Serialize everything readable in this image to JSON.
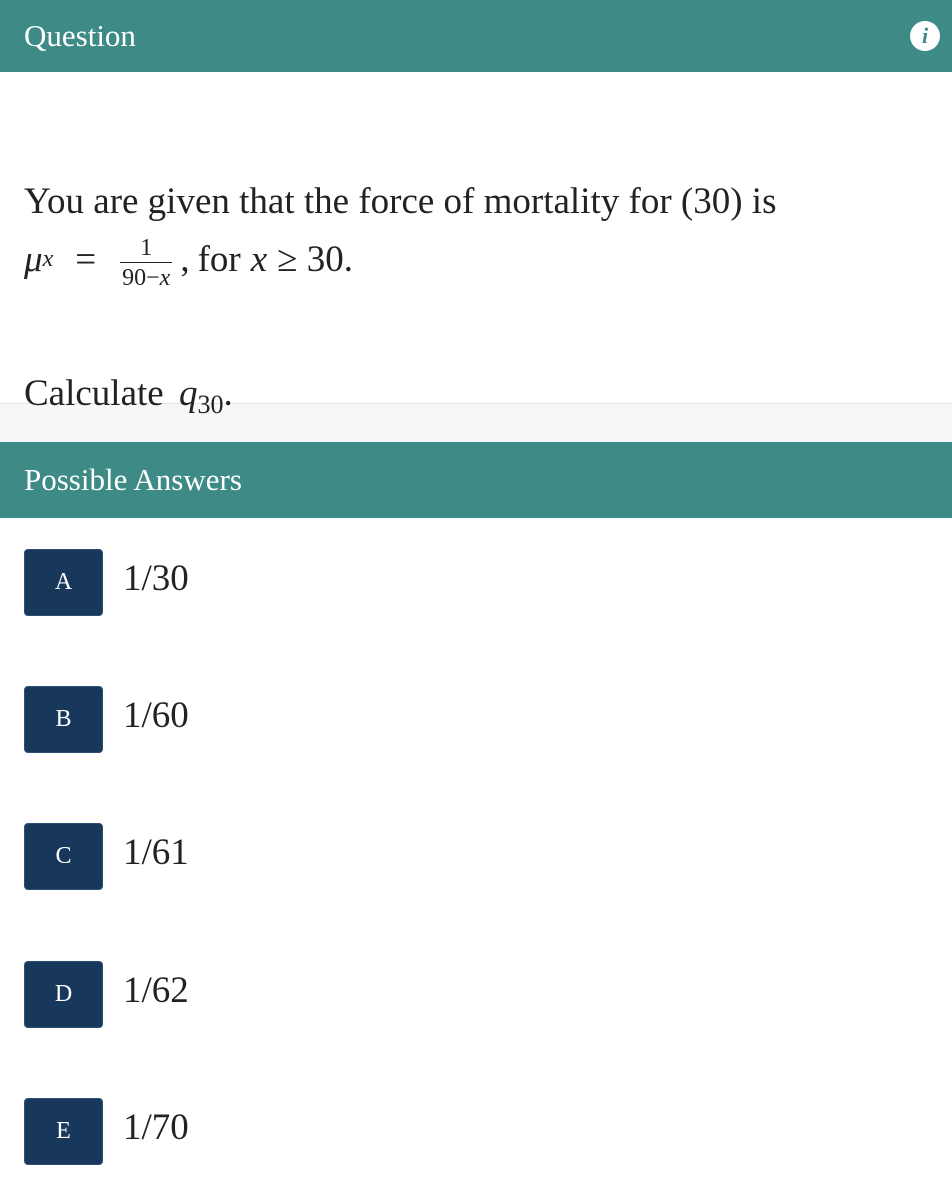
{
  "question_header": {
    "title": "Question",
    "info_icon": "info-icon"
  },
  "question": {
    "line1": "You are given that the force of mortality for (30) is",
    "mu_symbol": "μ",
    "mu_subscript": "x",
    "equals": "=",
    "fraction_numerator": "1",
    "fraction_denominator_a": "90−",
    "fraction_denominator_b": "x",
    "tail_comma": ",",
    "tail_for": "for",
    "tail_var": "x",
    "tail_rest": "≥ 30.",
    "calc_text": "Calculate",
    "calc_symbol": "q",
    "calc_subscript": "30",
    "calc_period": "."
  },
  "answers_header": {
    "title": "Possible Answers"
  },
  "answers": [
    {
      "letter": "A",
      "text": "1/30"
    },
    {
      "letter": "B",
      "text": "1/60"
    },
    {
      "letter": "C",
      "text": "1/61"
    },
    {
      "letter": "D",
      "text": "1/62"
    },
    {
      "letter": "E",
      "text": "1/70"
    }
  ],
  "colors": {
    "header": "#3e8a86",
    "badge": "#17375b",
    "strip": "#f6f7f9"
  }
}
